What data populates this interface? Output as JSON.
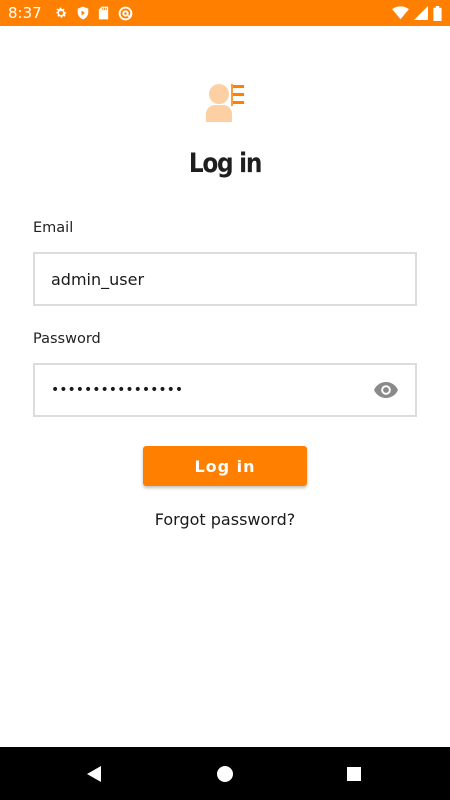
{
  "status_bar": {
    "time": "8:37",
    "left_icons": [
      "settings-icon",
      "shield-icon",
      "sd-card-icon",
      "at-sign-icon"
    ],
    "right_icons": [
      "wifi-icon",
      "signal-icon",
      "battery-icon"
    ]
  },
  "login": {
    "title": "Log in",
    "email": {
      "label": "Email",
      "value": "admin_user"
    },
    "password": {
      "label": "Password",
      "masked_value": "••••••••••••••••"
    },
    "login_button_label": "Log in",
    "forgot_password_label": "Forgot password?"
  },
  "nav_bar": {
    "icons": [
      "back-icon",
      "home-icon",
      "recents-icon"
    ]
  },
  "colors": {
    "accent": "#ff7f00",
    "logo_light": "#fdd0a3",
    "field_border": "#dcdcdc",
    "nav_background": "#000000"
  }
}
